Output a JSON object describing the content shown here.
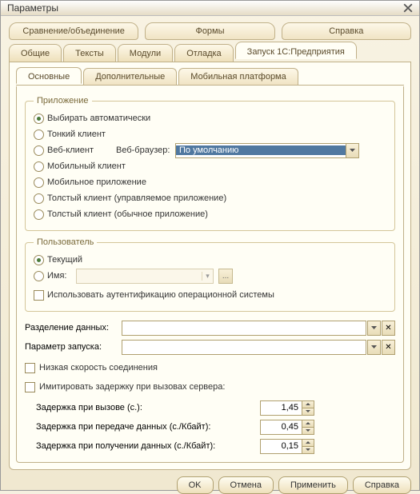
{
  "window": {
    "title": "Параметры"
  },
  "tabs_top": [
    "Сравнение/объединение",
    "Формы",
    "Справка"
  ],
  "tabs_mid": [
    "Общие",
    "Тексты",
    "Модули",
    "Отладка",
    "Запуск 1С:Предприятия"
  ],
  "tabs_mid_active": 4,
  "tabs_sub": [
    "Основные",
    "Дополнительные",
    "Мобильная платформа"
  ],
  "tabs_sub_active": 0,
  "app_group": {
    "legend": "Приложение",
    "options": [
      "Выбирать автоматически",
      "Тонкий клиент",
      "Веб-клиент",
      "Мобильный клиент",
      "Мобильное приложение",
      "Толстый клиент (управляемое приложение)",
      "Толстый клиент (обычное приложение)"
    ],
    "selected": 0,
    "web_browser_label": "Веб-браузер:",
    "web_browser_value": "По умолчанию"
  },
  "user_group": {
    "legend": "Пользователь",
    "current": "Текущий",
    "name": "Имя:",
    "selected": 0,
    "use_os_auth": "Использовать аутентификацию операционной системы"
  },
  "split_label": "Разделение данных:",
  "launch_label": "Параметр запуска:",
  "low_speed": "Низкая скорость соединения",
  "imitate_delay": "Имитировать задержку при вызовах сервера:",
  "delays": {
    "call_label": "Задержка при вызове (с.):",
    "call_value": "1,45",
    "send_label": "Задержка при передаче данных (с./Кбайт):",
    "send_value": "0,45",
    "recv_label": "Задержка при получении данных (с./Кбайт):",
    "recv_value": "0,15"
  },
  "buttons": {
    "ok": "OK",
    "cancel": "Отмена",
    "apply": "Применить",
    "help": "Справка"
  }
}
